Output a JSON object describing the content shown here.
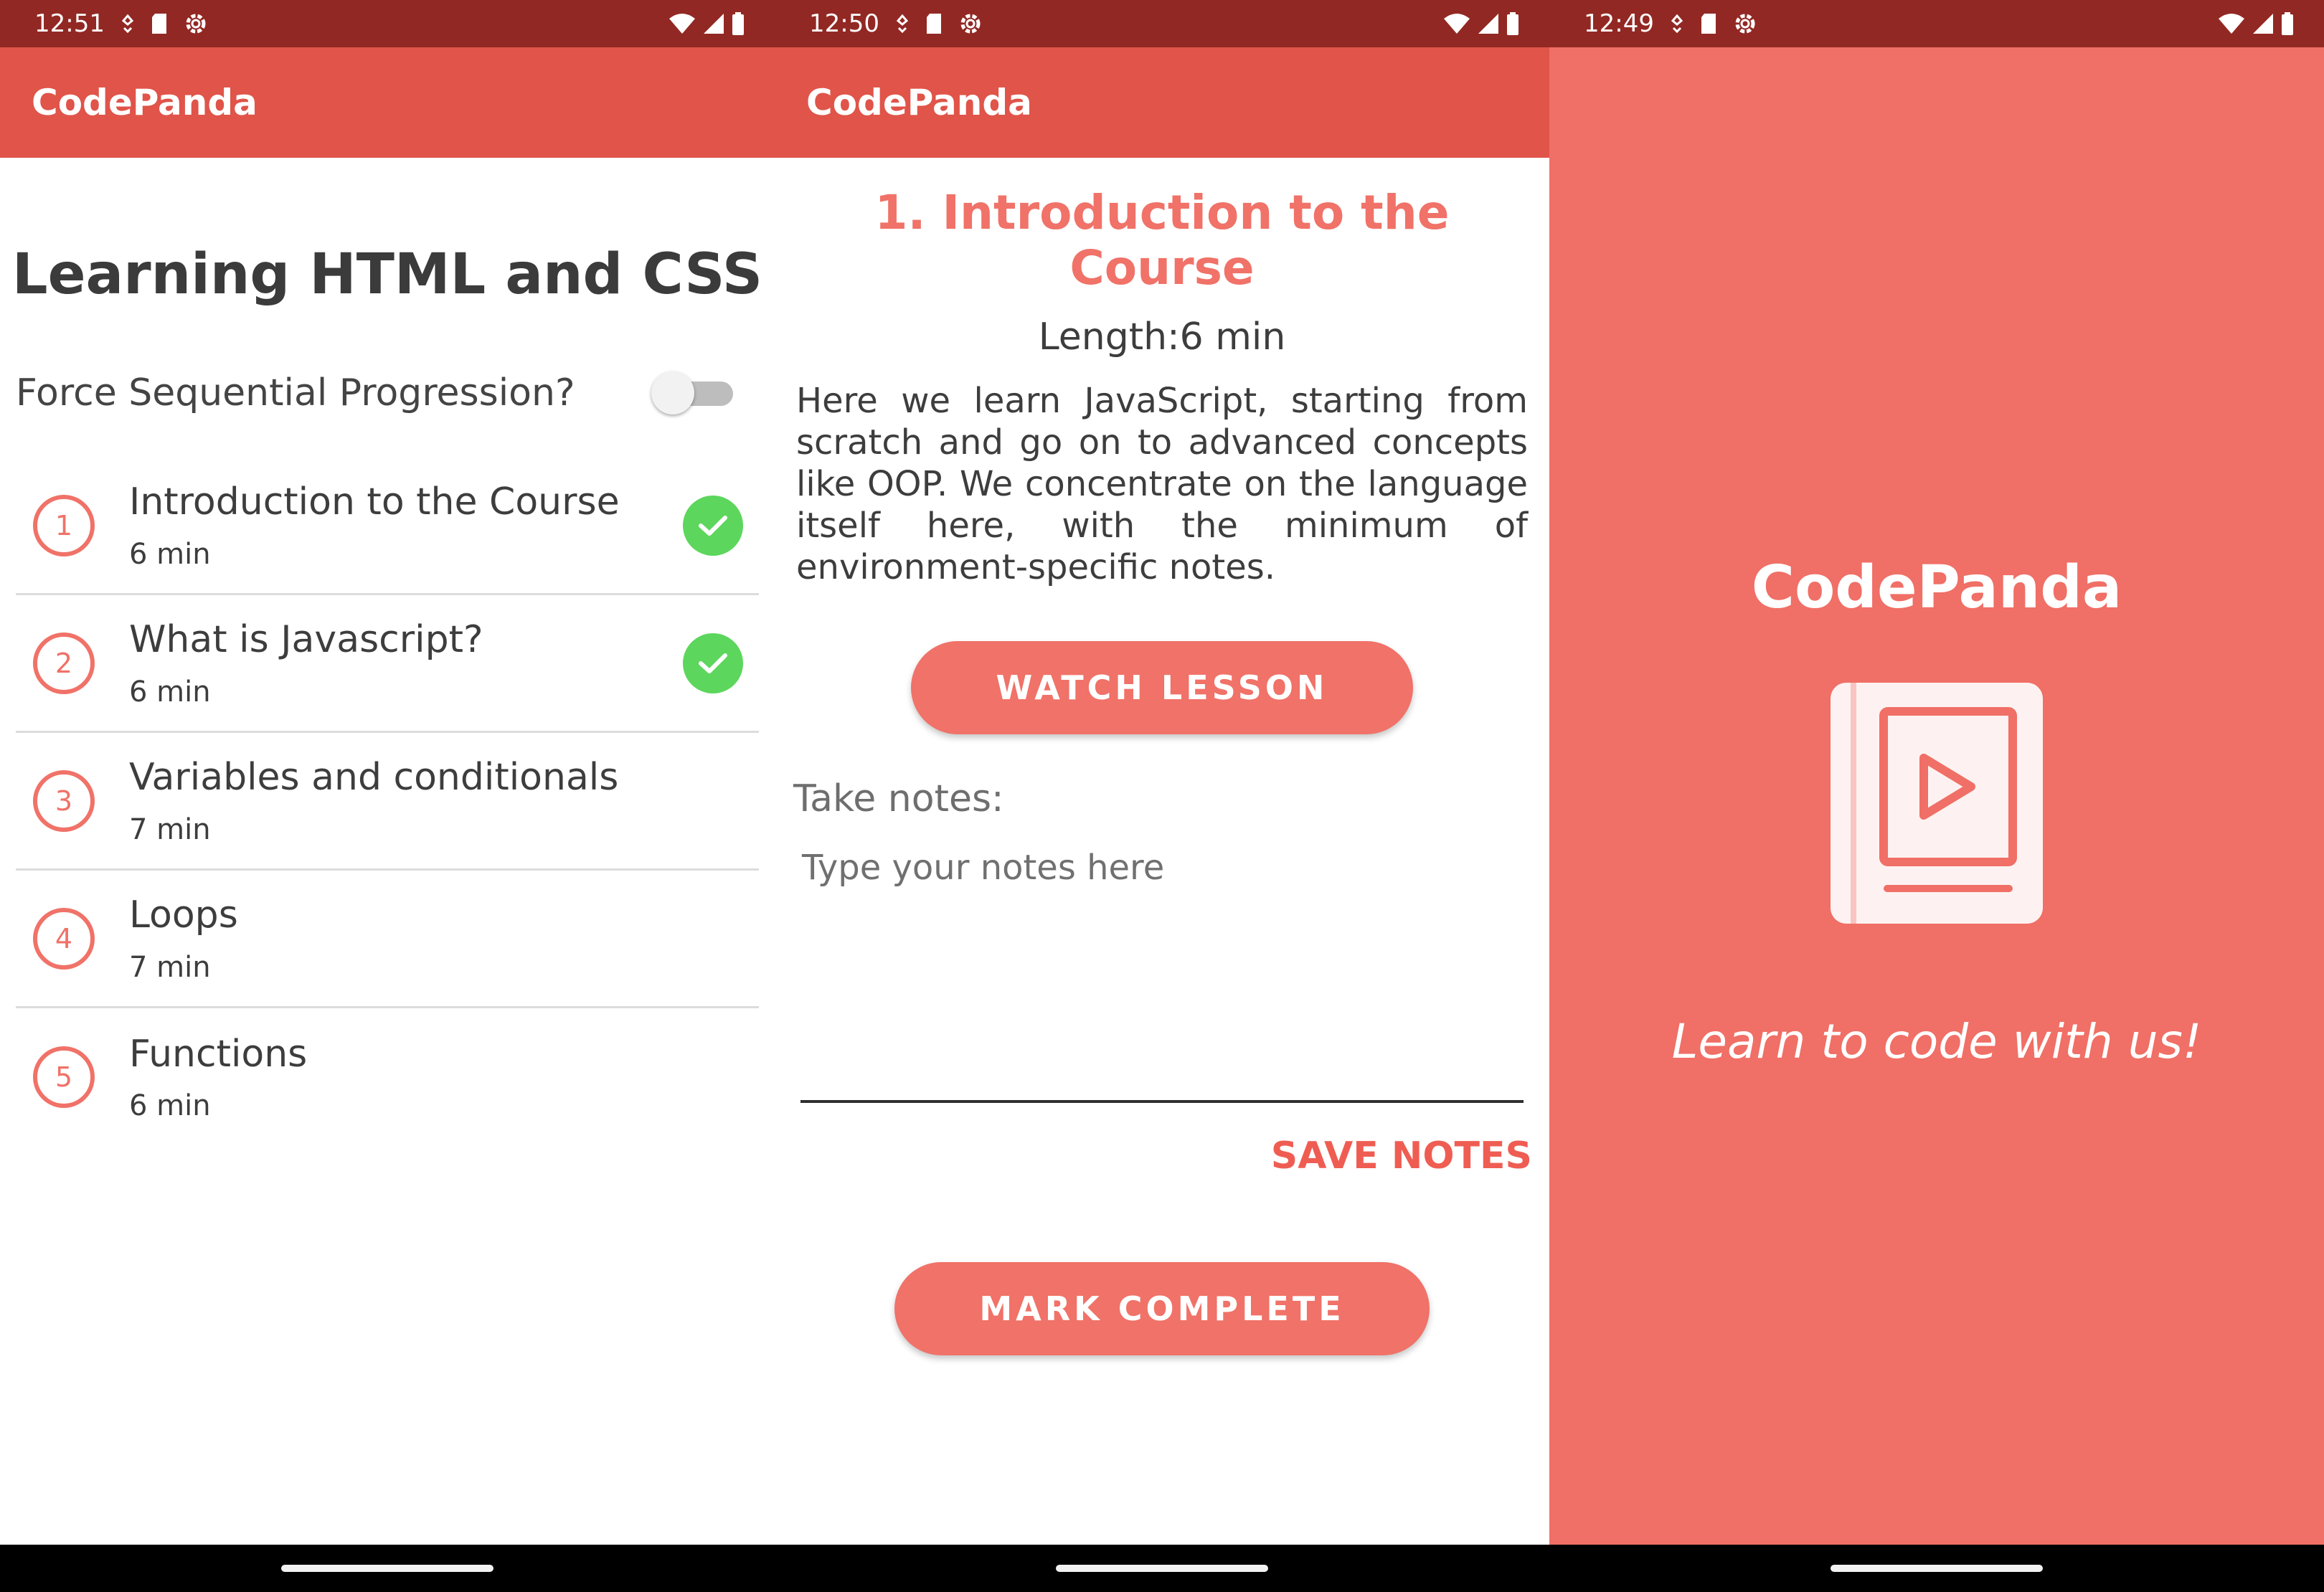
{
  "screens": [
    {
      "status": {
        "time": "12:51"
      },
      "app_title": "CodePanda",
      "course_title": "Learning HTML and CSS",
      "toggle": {
        "label": "Force Sequential Progression?",
        "on": false
      },
      "lessons": [
        {
          "number": "1",
          "title": "Introduction to the Course",
          "length": "6 min",
          "completed": true
        },
        {
          "number": "2",
          "title": "What is Javascript?",
          "length": "6 min",
          "completed": true
        },
        {
          "number": "3",
          "title": "Variables and conditionals",
          "length": "7 min",
          "completed": false
        },
        {
          "number": "4",
          "title": "Loops",
          "length": "7 min",
          "completed": false
        },
        {
          "number": "5",
          "title": "Functions",
          "length": "6 min",
          "completed": false
        }
      ]
    },
    {
      "status": {
        "time": "12:50"
      },
      "app_title": "CodePanda",
      "lesson_heading": "1. Introduction to the Course",
      "length_line": "Length:6 min",
      "description": "Here we learn JavaScript, starting from scratch and go on to advanced concepts like OOP. We concentrate on the language itself here, with the minimum of environment-specific notes.",
      "watch_button": "WATCH LESSON",
      "notes_label": "Take notes:",
      "notes_placeholder": "Type your notes here",
      "save_button": "SAVE NOTES",
      "mark_button": "MARK COMPLETE"
    },
    {
      "status": {
        "time": "12:49"
      },
      "app_name": "CodePanda",
      "tagline": "Learn to code with us!"
    }
  ],
  "colors": {
    "status_bar": "#922823",
    "app_bar": "#e05449",
    "accent": "#f07268",
    "splash_bg": "#f06f66",
    "check_green": "#5cd65c"
  },
  "icons": [
    "location-icon",
    "sd-card-icon",
    "settings-icon",
    "wifi-icon",
    "signal-icon",
    "battery-icon",
    "check-icon",
    "book-play-icon"
  ]
}
